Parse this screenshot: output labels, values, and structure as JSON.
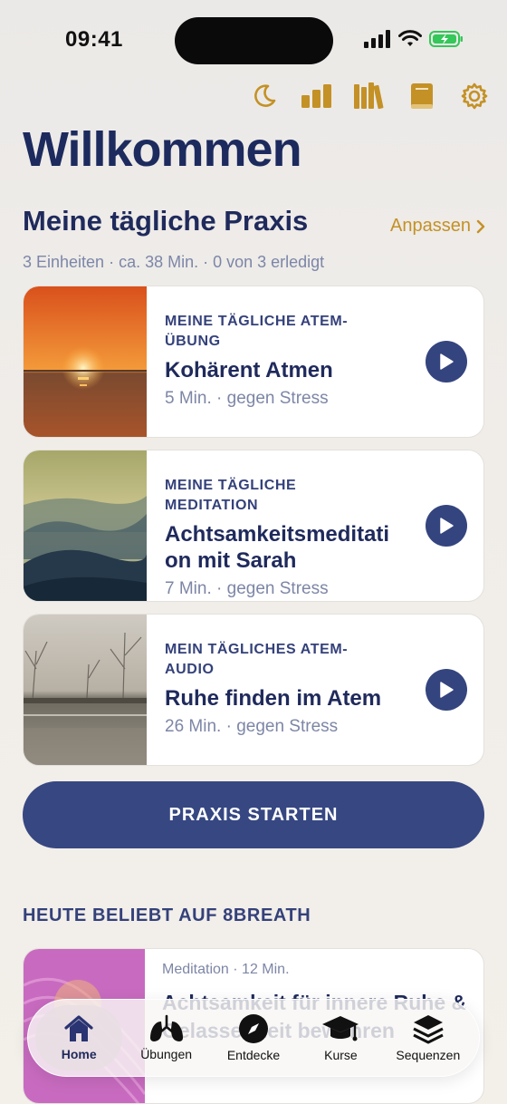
{
  "status": {
    "time": "09:41"
  },
  "top_icons": [
    "moon-icon",
    "bar-chart-icon",
    "library-icon",
    "book-icon",
    "gear-icon"
  ],
  "title": "Willkommen",
  "practice": {
    "title": "Meine tägliche Praxis",
    "adjust_label": "Anpassen",
    "summary": "3 Einheiten · ca. 38 Min. · 0 von 3 erledigt",
    "items": [
      {
        "kicker": "MEINE TÄGLICHE ATEM-ÜBUNG",
        "title": "Kohärent Atmen",
        "meta": "5 Min. · gegen Stress"
      },
      {
        "kicker": "MEINE TÄGLICHE MEDITATION",
        "title": "Achtsamkeitsmeditation mit Sarah",
        "meta": "7 Min. · gegen Stress"
      },
      {
        "kicker": "MEIN TÄGLICHES ATEM-AUDIO",
        "title": "Ruhe finden im Atem",
        "meta": "26 Min. · gegen Stress"
      }
    ],
    "start_label": "PRAXIS STARTEN"
  },
  "popular": {
    "title": "HEUTE BELIEBT AUF 8BREATH",
    "card": {
      "meta": "Meditation · 12 Min.",
      "title": "Achtsamkeit für innere Ruhe & Gelassenheit bewahren"
    }
  },
  "tabs": [
    {
      "label": "Home",
      "icon": "home-icon",
      "active": true
    },
    {
      "label": "Übungen",
      "icon": "lungs-icon"
    },
    {
      "label": "Entdecke",
      "icon": "compass-icon"
    },
    {
      "label": "Kurse",
      "icon": "graduation-cap-icon"
    },
    {
      "label": "Sequenzen",
      "icon": "layers-icon"
    }
  ],
  "colors": {
    "navy": "#1f2a5c",
    "button": "#364782",
    "gold": "#c49126"
  }
}
